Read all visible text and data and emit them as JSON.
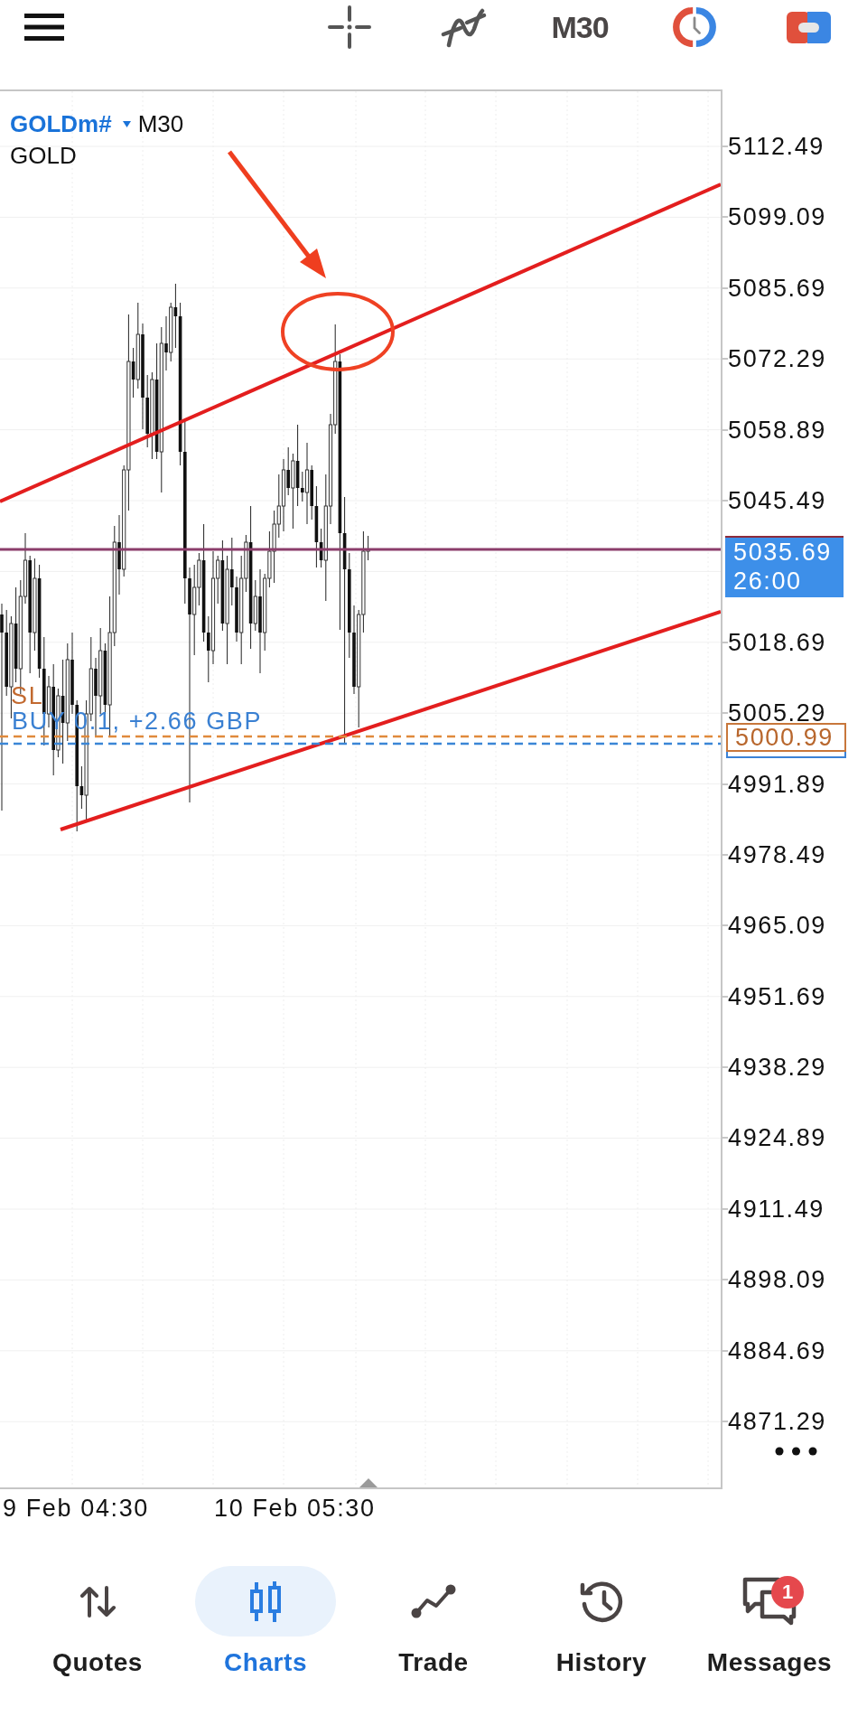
{
  "toolbar": {
    "timeframe": "M30"
  },
  "chart": {
    "symbol": "GOLDm#",
    "timeframe": "M30",
    "description": "GOLD",
    "stop_loss": {
      "label": "SL",
      "price": "5000.99"
    },
    "position": {
      "label": "BUY 0.1, +2.66 GBP"
    },
    "price_axis": {
      "upper_labels": [
        "5112.49",
        "5099.09",
        "5085.69",
        "5072.29",
        "5058.89",
        "5045.49"
      ],
      "bid_tag": {
        "price": "5035.69",
        "countdown": "26:00"
      },
      "lower_labels": [
        "5018.69",
        "5005.29",
        "4991.89",
        "4978.49",
        "4965.09",
        "4951.69",
        "4938.29",
        "4924.89",
        "4911.49",
        "4898.09",
        "4884.69",
        "4871.29"
      ]
    },
    "time_axis": [
      "9 Feb 04:30",
      "10 Feb 05:30"
    ]
  },
  "nav": [
    {
      "label": "Quotes",
      "selected": false
    },
    {
      "label": "Charts",
      "selected": true
    },
    {
      "label": "Trade",
      "selected": false
    },
    {
      "label": "History",
      "selected": false
    },
    {
      "label": "Messages",
      "selected": false,
      "badge": "1"
    }
  ]
}
